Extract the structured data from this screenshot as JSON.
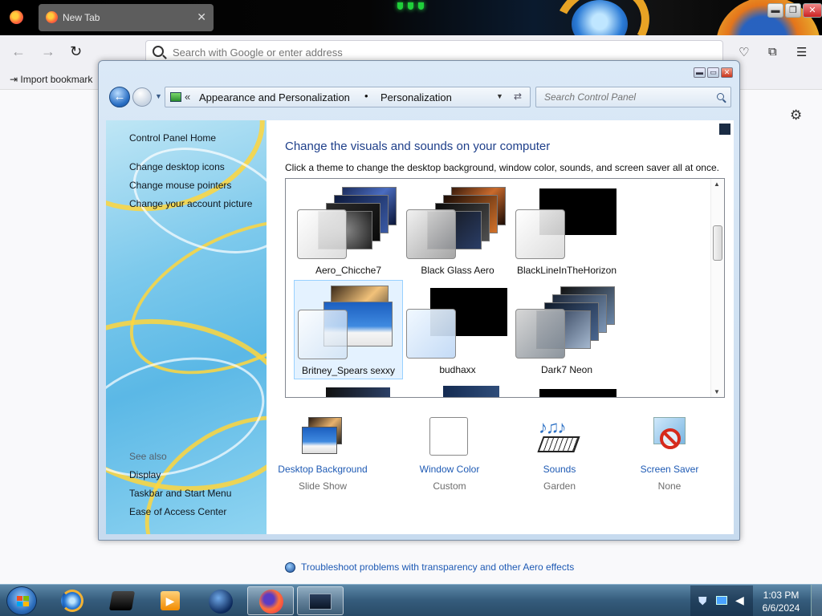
{
  "browser": {
    "tab_title": "New Tab",
    "tab_close": "✕",
    "address_placeholder": "Search with Google or enter address",
    "bookmarks_import": "Import bookmark",
    "window_buttons": {
      "minimize": "▬",
      "restore": "❐",
      "close": "✕"
    }
  },
  "control_panel": {
    "window_buttons": {
      "minimize": "▬",
      "restore": "▭",
      "close": "✕"
    },
    "breadcrumb": {
      "overflow": "«",
      "level1": "Appearance and Personalization",
      "separator": "•",
      "level2": "Personalization"
    },
    "search_placeholder": "Search Control Panel",
    "sidebar": {
      "home": "Control Panel Home",
      "links": [
        "Change desktop icons",
        "Change mouse pointers",
        "Change your account picture"
      ],
      "see_also_label": "See also",
      "see_also": [
        "Display",
        "Taskbar and Start Menu",
        "Ease of Access Center"
      ]
    },
    "main": {
      "heading": "Change the visuals and sounds on your computer",
      "subtitle": "Click a theme to change the desktop background, window color, sounds, and screen saver all at once.",
      "themes": [
        {
          "name": "Aero_Chicche7",
          "selected": false
        },
        {
          "name": "Black Glass Aero",
          "selected": false
        },
        {
          "name": "BlackLineInTheHorizon",
          "selected": false
        },
        {
          "name": "Britney_Spears sexxy",
          "selected": true
        },
        {
          "name": "budhaxx",
          "selected": false
        },
        {
          "name": "Dark7 Neon",
          "selected": false
        }
      ],
      "tools": [
        {
          "name": "Desktop Background",
          "value": "Slide Show",
          "icon": "desktop-background-icon"
        },
        {
          "name": "Window Color",
          "value": "Custom",
          "icon": "window-color-icon"
        },
        {
          "name": "Sounds",
          "value": "Garden",
          "icon": "sounds-icon"
        },
        {
          "name": "Screen Saver",
          "value": "None",
          "icon": "screen-saver-icon"
        }
      ],
      "troubleshoot": "Troubleshoot problems with transparency and other Aero effects"
    }
  },
  "taskbar": {
    "time": "1:03 PM",
    "date": "6/6/2024"
  },
  "colors": {
    "link": "#1e5ab4",
    "heading": "#1e3f8a",
    "selection": "#cde8ff"
  }
}
